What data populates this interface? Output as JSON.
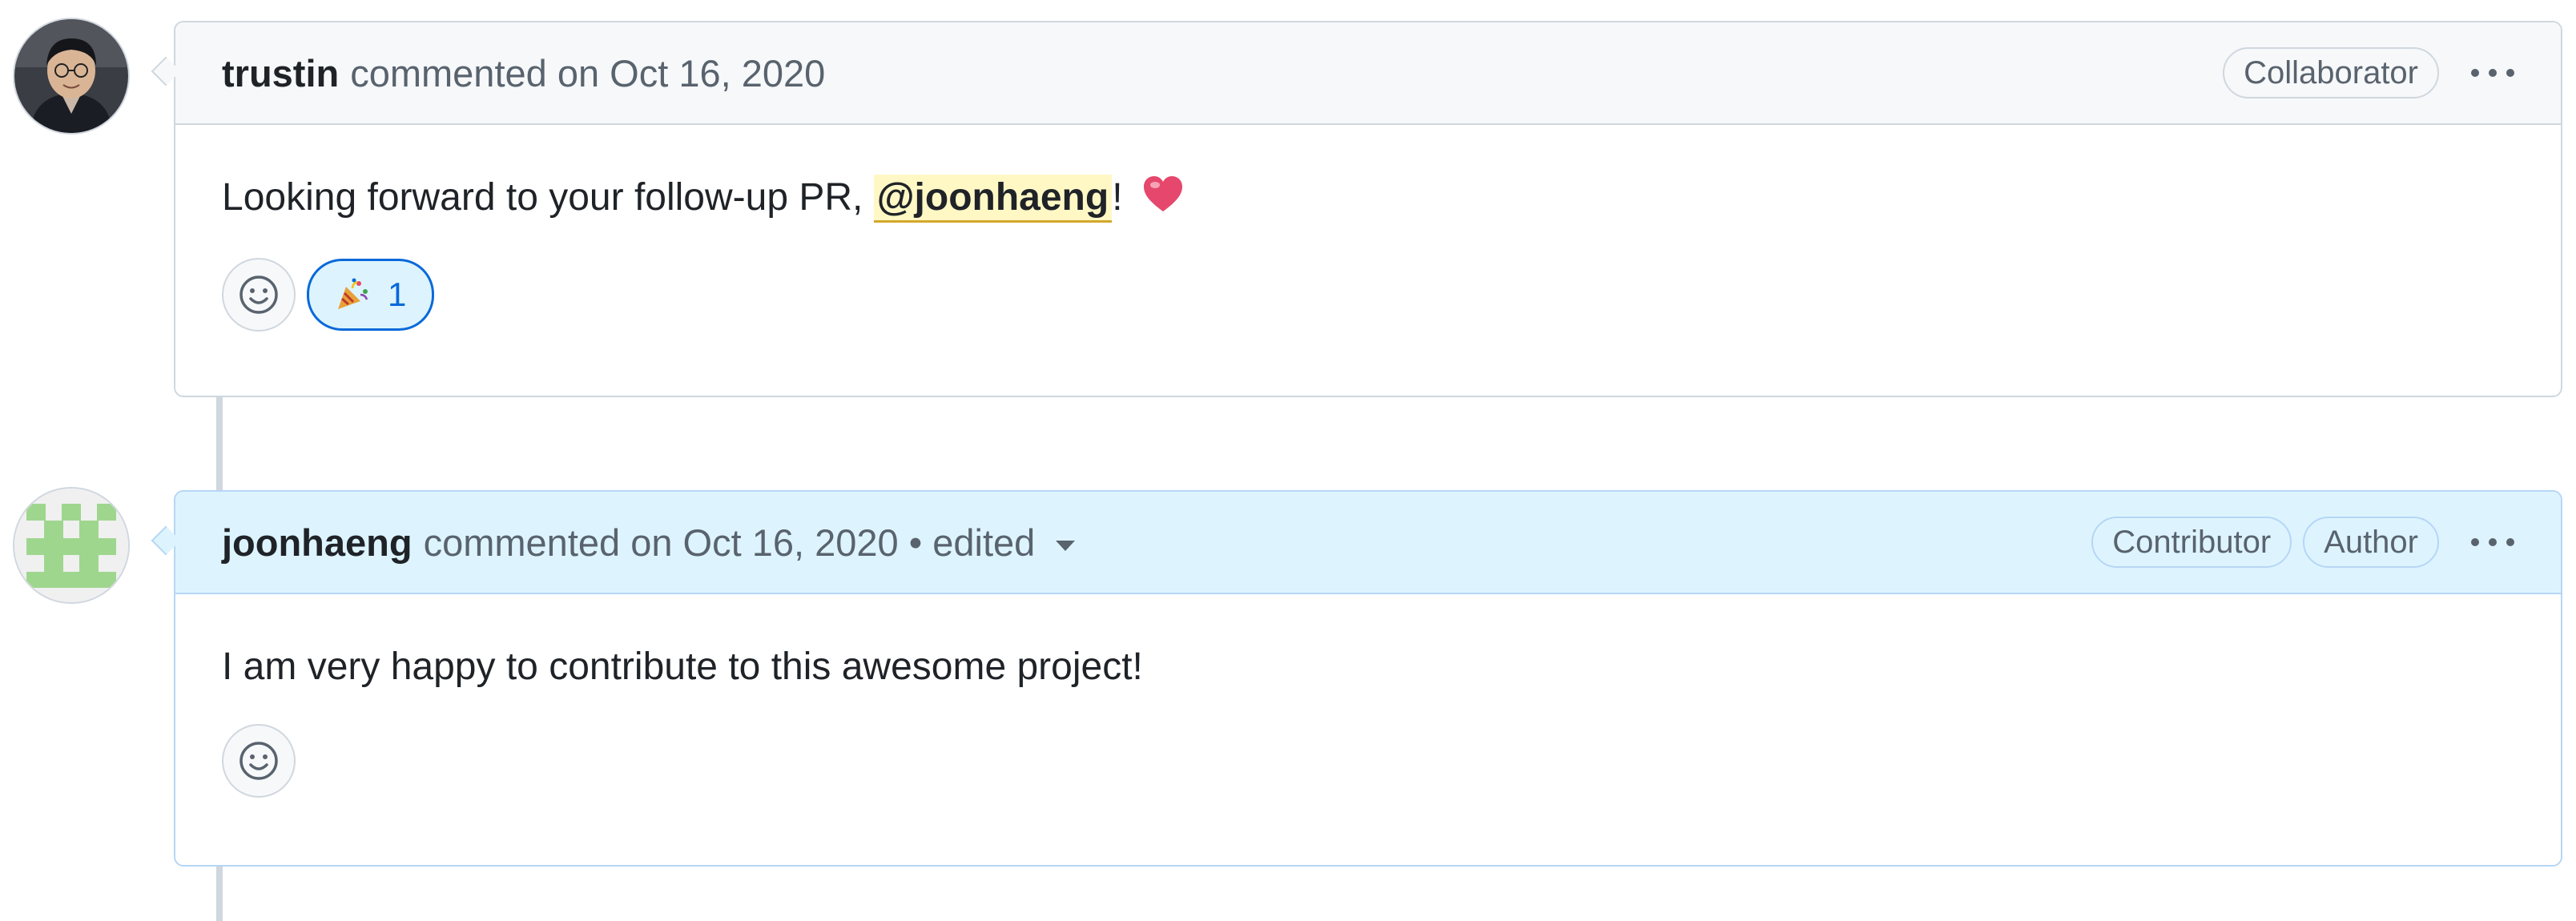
{
  "comments": [
    {
      "username": "trustin",
      "meta": "commented on Oct 16, 2020",
      "badges": [
        "Collaborator"
      ],
      "body": {
        "before_mention": "Looking forward to your follow-up PR, ",
        "mention": "@joonhaeng",
        "after_mention": "!",
        "emoji_icon": "heart-icon"
      },
      "reactions": [
        {
          "icon": "tada-icon",
          "count": "1"
        }
      ]
    },
    {
      "username": "joonhaeng",
      "meta": "commented on Oct 16, 2020 • edited",
      "badges": [
        "Contributor",
        "Author"
      ],
      "body": {
        "text": "I am very happy to contribute to this awesome project!"
      },
      "reactions": []
    }
  ],
  "colors": {
    "header_default": "#f6f8fa",
    "header_author": "#ddf4ff",
    "mention_bg": "#fff8c5",
    "reaction_accent": "#0969da"
  }
}
